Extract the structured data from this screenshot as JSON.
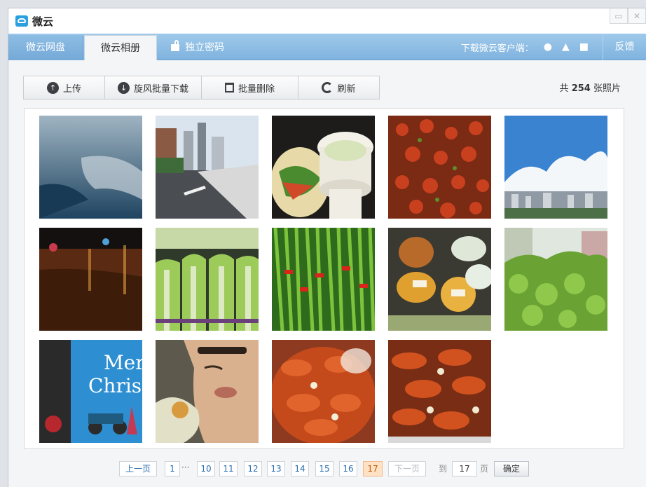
{
  "window": {
    "title": "微云",
    "minimize_icon": "minimize-icon",
    "close_icon": "close-icon"
  },
  "nav": {
    "tabs": [
      {
        "label": "微云网盘"
      },
      {
        "label": "微云相册",
        "active": true
      },
      {
        "label": "独立密码",
        "icon": "lock-icon"
      }
    ],
    "client_label": "下载微云客户端：",
    "client_icons": [
      "apple-icon",
      "android-icon",
      "windows-icon"
    ],
    "feedback": "反馈"
  },
  "toolbar": {
    "upload": "上传",
    "batch_download": "旋风批量下载",
    "batch_delete": "批量删除",
    "refresh": "刷新"
  },
  "count": {
    "prefix": "共",
    "number": "254",
    "suffix": "张照片"
  },
  "photos": [
    "water-reflection",
    "city-street",
    "noodles-cup",
    "crayfish-bowl",
    "blue-sky-clouds",
    "night-street",
    "lettuce",
    "green-beans",
    "vegetable-stall",
    "green-shrubs",
    "christmas-mural",
    "person-eating",
    "crayfish-plate",
    "crayfish-dish"
  ],
  "pager": {
    "prev": "上一页",
    "first": "1",
    "ellipsis": "···",
    "pages": [
      "10",
      "11",
      "12",
      "13",
      "14",
      "15",
      "16",
      "17"
    ],
    "current": "17",
    "next": "下一页",
    "goto_label": "到",
    "goto_value": "17",
    "page_unit": "页",
    "confirm": "确定"
  },
  "colors": {
    "nav_blue": "#7fb3df",
    "active_page": "#ffe2c4",
    "link_blue": "#2a6eb1"
  }
}
